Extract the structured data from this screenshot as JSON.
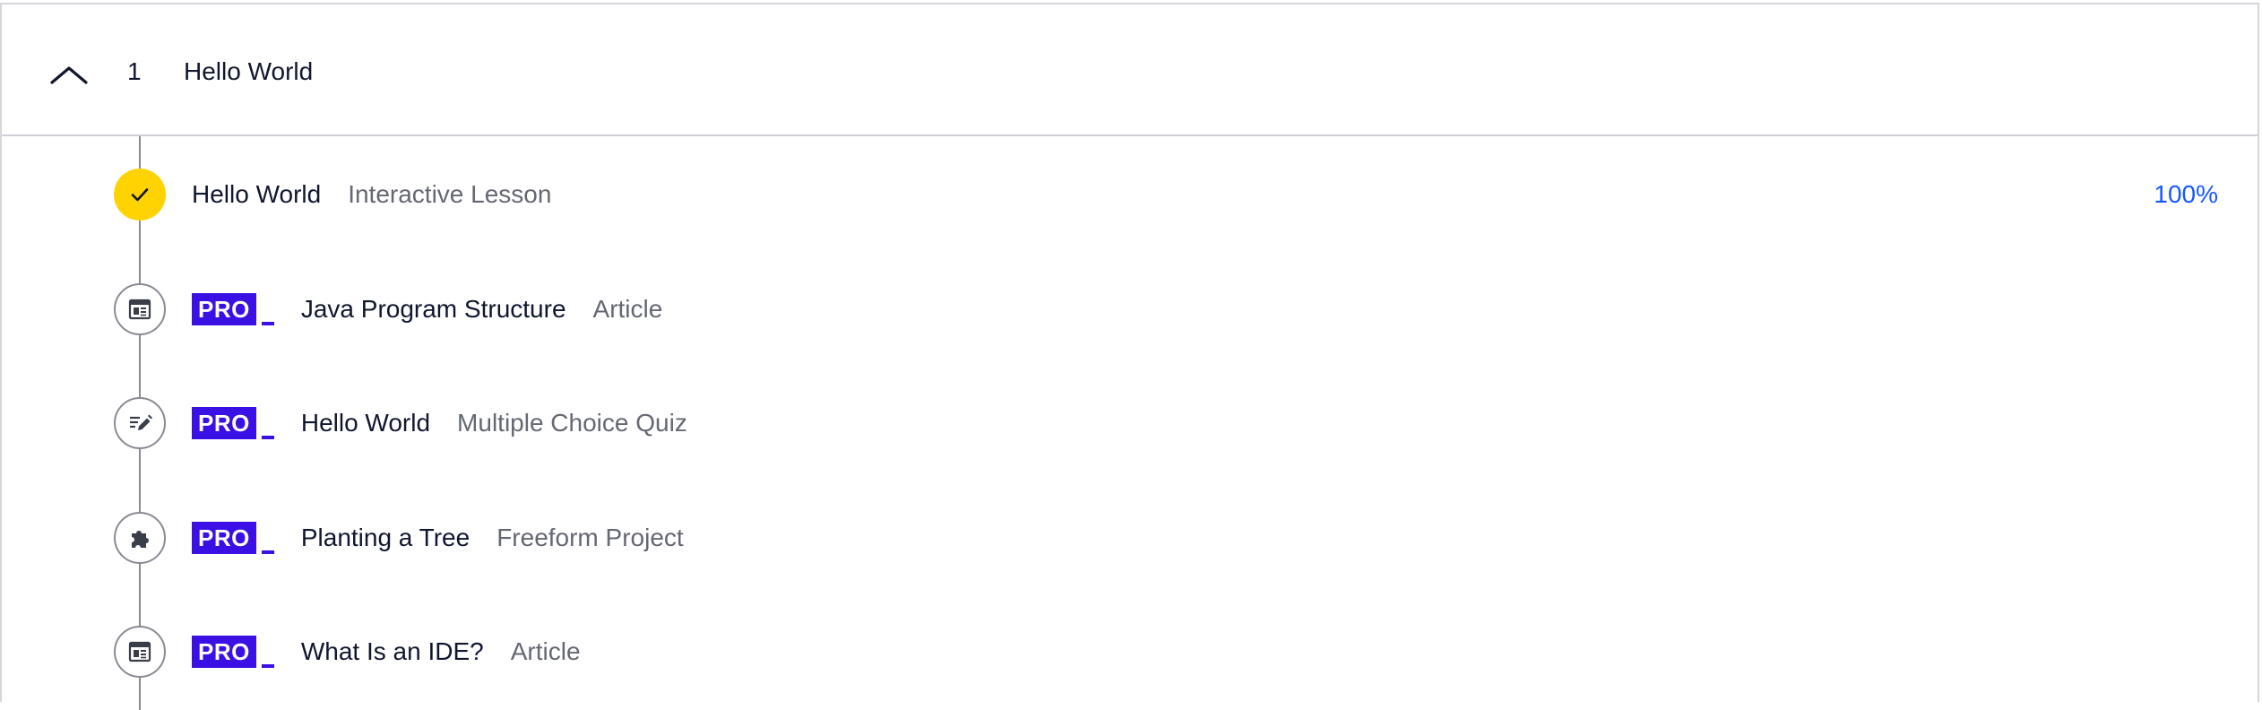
{
  "module": {
    "number": "1",
    "title": "Hello World",
    "expanded": true
  },
  "colors": {
    "pro_badge": "#3a10e5",
    "complete": "#ffd300",
    "progress_text": "#1557ff",
    "secondary_text": "#656873"
  },
  "lessons": [
    {
      "title": "Hello World",
      "type": "Interactive Lesson",
      "icon": "check-icon",
      "completed": true,
      "pro": false,
      "progress": "100%"
    },
    {
      "title": "Java Program Structure",
      "type": "Article",
      "icon": "article-icon",
      "completed": false,
      "pro": true,
      "pro_label": "PRO"
    },
    {
      "title": "Hello World",
      "type": "Multiple Choice Quiz",
      "icon": "quiz-icon",
      "completed": false,
      "pro": true,
      "pro_label": "PRO"
    },
    {
      "title": "Planting a Tree",
      "type": "Freeform Project",
      "icon": "puzzle-icon",
      "completed": false,
      "pro": true,
      "pro_label": "PRO"
    },
    {
      "title": "What Is an IDE?",
      "type": "Article",
      "icon": "article-icon",
      "completed": false,
      "pro": true,
      "pro_label": "PRO"
    }
  ]
}
